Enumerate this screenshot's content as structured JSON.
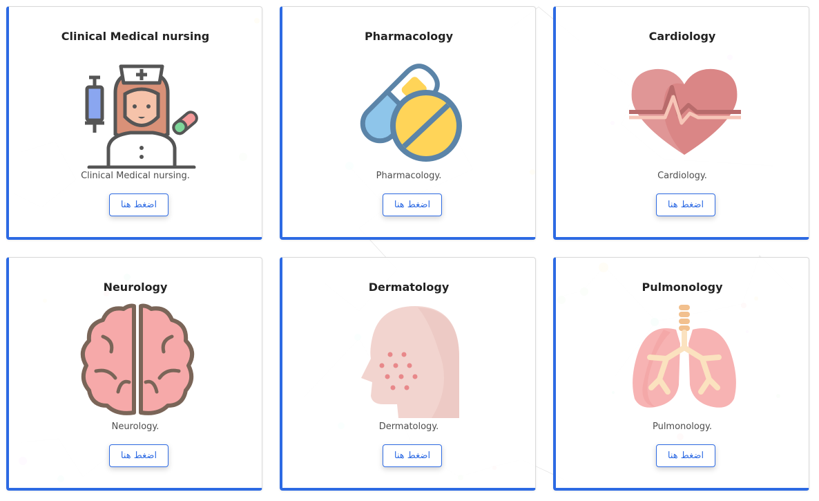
{
  "cards": [
    {
      "title": "Clinical Medical nursing",
      "description": "Clinical Medical nursing.",
      "button_label": "اضغط هنا",
      "icon": "nurse-icon"
    },
    {
      "title": "Pharmacology",
      "description": "Pharmacology.",
      "button_label": "اضغط هنا",
      "icon": "pill-capsule-icon"
    },
    {
      "title": "Cardiology",
      "description": "Cardiology.",
      "button_label": "اضغط هنا",
      "icon": "heart-pulse-icon"
    },
    {
      "title": "Neurology",
      "description": "Neurology.",
      "button_label": "اضغط هنا",
      "icon": "brain-icon"
    },
    {
      "title": "Dermatology",
      "description": "Dermatology.",
      "button_label": "اضغط هنا",
      "icon": "face-skin-icon"
    },
    {
      "title": "Pulmonology",
      "description": "Pulmonology.",
      "button_label": "اضغط هنا",
      "icon": "lungs-icon"
    }
  ],
  "colors": {
    "accent": "#2d6ae3",
    "background": "#ffffff",
    "title": "#222222",
    "description": "#4d4d4d"
  }
}
